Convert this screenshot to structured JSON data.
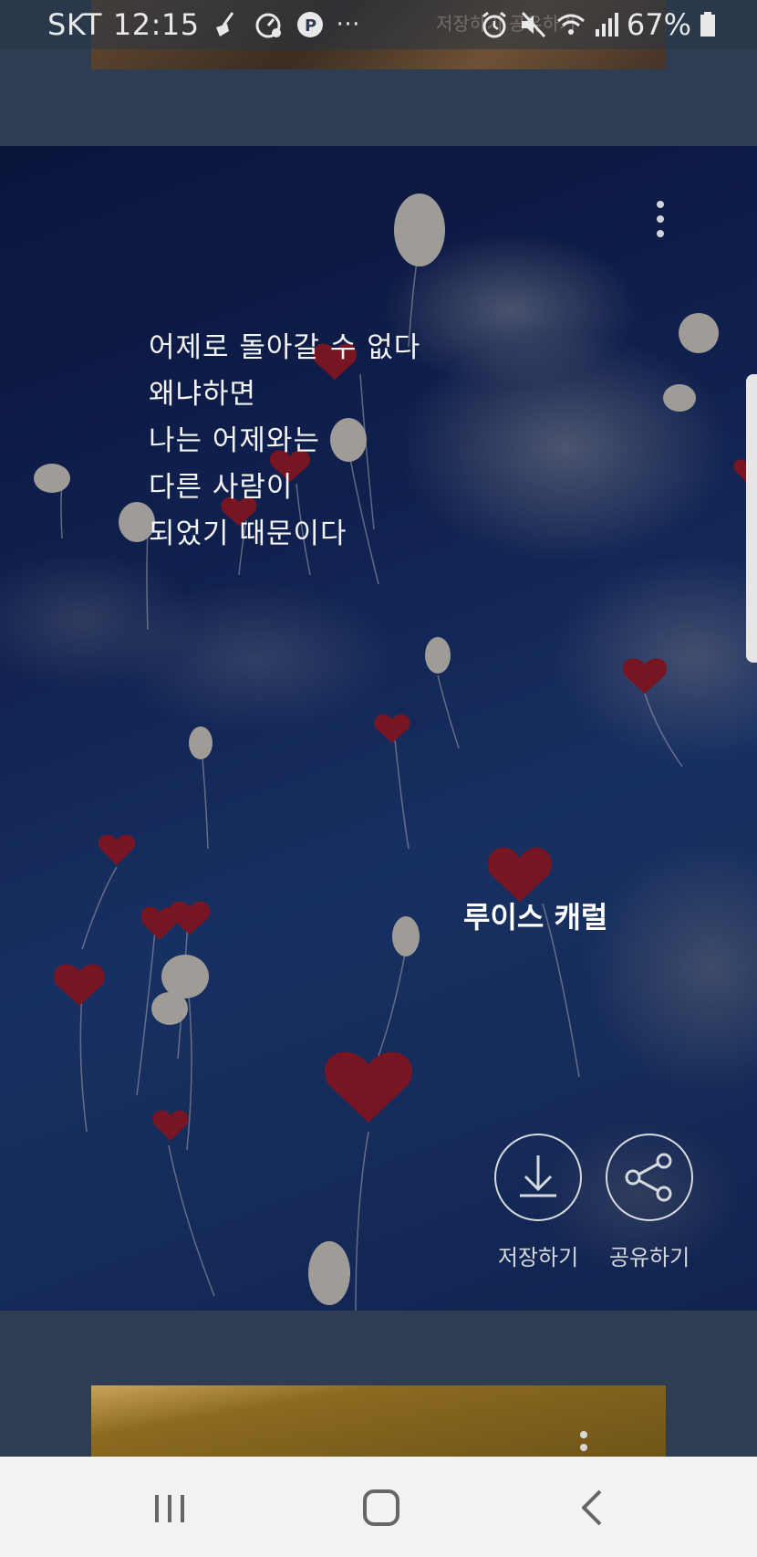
{
  "status_bar": {
    "carrier": "SKT",
    "time": "12:15",
    "battery": "67%",
    "overflow": "···",
    "ghost_text": "저장하기  공유하기",
    "icons": [
      "broom-icon",
      "speedometer-icon",
      "parking-icon",
      "alarm-icon",
      "mute-icon",
      "wifi-icon",
      "signal-icon",
      "battery-icon"
    ]
  },
  "card": {
    "poem_lines": [
      "어제로 돌아갈 수 없다",
      "왜냐하면",
      "나는 어제와는",
      "다른 사람이",
      "되었기 때문이다"
    ],
    "author": "루이스 캐럴",
    "save_label": "저장하기",
    "share_label": "공유하기"
  },
  "colors": {
    "background": "#2e3d52",
    "navbar": "#f2f2f2",
    "accent_text": "#ffffff"
  },
  "nav": {
    "icons": [
      "recent-apps-icon",
      "home-icon",
      "back-icon"
    ]
  }
}
